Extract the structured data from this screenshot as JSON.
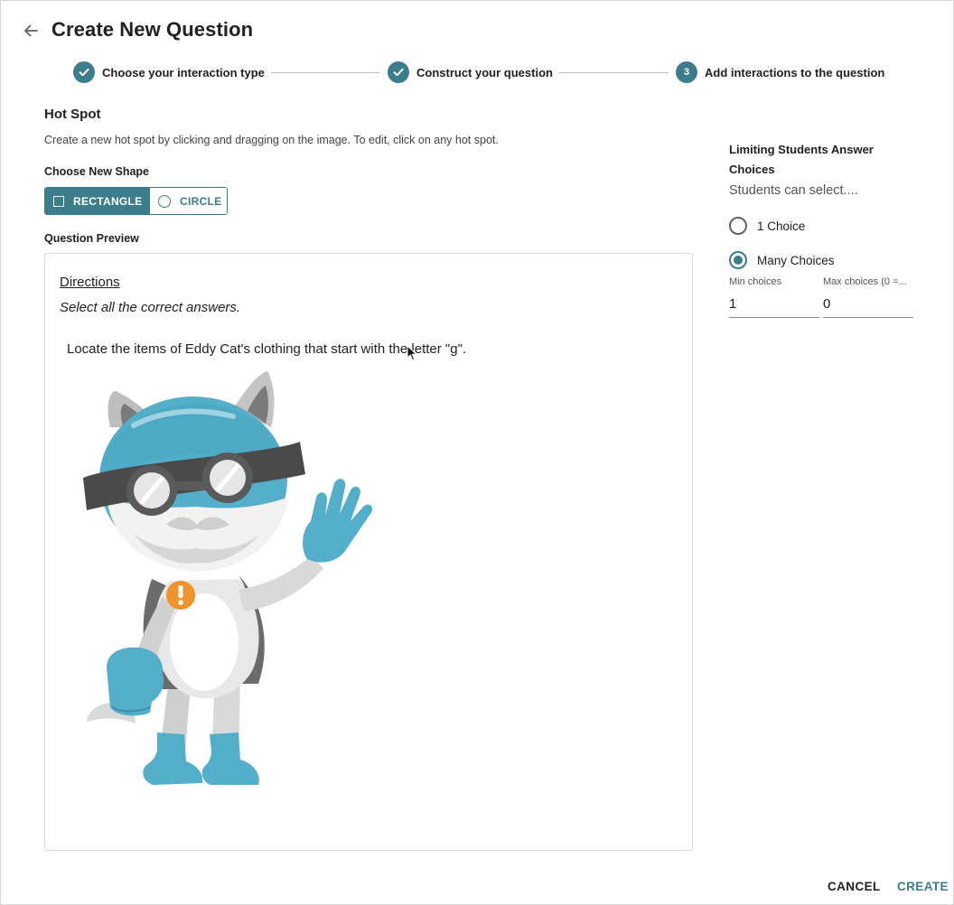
{
  "header": {
    "title": "Create New Question",
    "back_icon": "arrow-left-icon"
  },
  "stepper": {
    "steps": [
      {
        "label": "Choose your interaction type",
        "state": "done",
        "icon": "check-icon"
      },
      {
        "label": "Construct your question",
        "state": "done",
        "icon": "check-icon"
      },
      {
        "label": "Add interactions to the question",
        "state": "active",
        "number": "3"
      }
    ]
  },
  "hotspot": {
    "title": "Hot Spot",
    "description": "Create a new hot spot by clicking and dragging on the image. To edit, click on any hot spot.",
    "shape_label": "Choose New Shape",
    "shapes": {
      "rectangle": "RECTANGLE",
      "circle": "CIRCLE",
      "selected": "rectangle"
    }
  },
  "preview": {
    "label": "Question Preview",
    "directions_heading": "Directions",
    "instruction": "Select all the correct answers.",
    "question": "Locate the items of Eddy Cat's clothing that start with the letter \"g\".",
    "image": "eddy-cat-mascot-waving"
  },
  "limits": {
    "title": "Limiting Students Answer Choices",
    "subtitle": "Students can select....",
    "options": [
      {
        "label": "1 Choice",
        "checked": false
      },
      {
        "label": "Many Choices",
        "checked": true
      }
    ],
    "min_label": "Min choices",
    "min_value": "1",
    "max_label": "Max choices (0 =...",
    "max_value": "0"
  },
  "footer": {
    "cancel": "CANCEL",
    "create": "CREATE"
  },
  "colors": {
    "accent": "#3c7d8c",
    "mascot_blue": "#52aec9",
    "badge_orange": "#f0932b"
  }
}
